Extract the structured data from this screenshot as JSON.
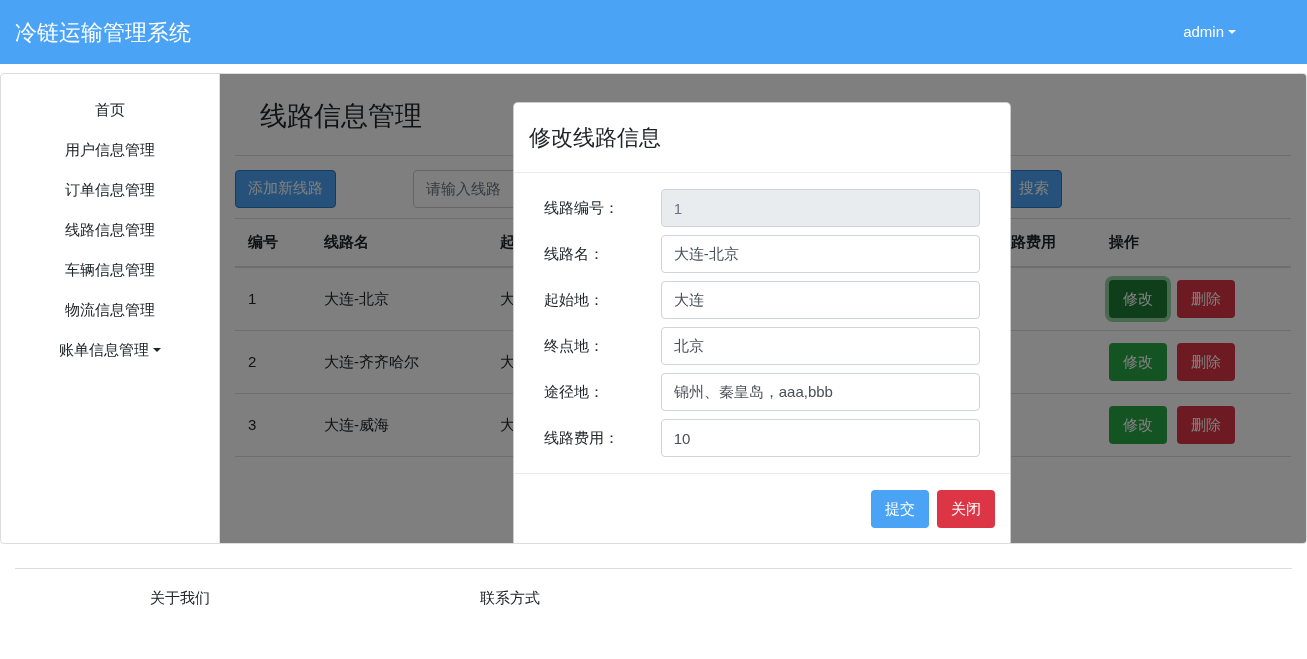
{
  "navbar": {
    "title": "冷链运输管理系统",
    "user_menu": "admin"
  },
  "sidebar": {
    "items": [
      {
        "label": "首页",
        "kind": "link"
      },
      {
        "label": "用户信息管理",
        "kind": "link"
      },
      {
        "label": "订单信息管理",
        "kind": "link"
      },
      {
        "label": "线路信息管理",
        "kind": "link"
      },
      {
        "label": "车辆信息管理",
        "kind": "link"
      },
      {
        "label": "物流信息管理",
        "kind": "link"
      },
      {
        "label": "账单信息管理",
        "kind": "dropdown"
      }
    ]
  },
  "page": {
    "title": "线路信息管理",
    "add_button": "添加新线路",
    "search": {
      "placeholder": "请输入线路"
    },
    "search_button": "搜索",
    "table": {
      "columns": [
        "编号",
        "线路名",
        "起",
        "路费用",
        "操作"
      ],
      "rows": [
        {
          "id": "1",
          "name": "大连-北京",
          "column_3": "大",
          "edit": "修改",
          "delete": "删除",
          "focused": true
        },
        {
          "id": "2",
          "name": "大连-齐齐哈尔",
          "column_3": "大",
          "edit": "修改",
          "delete": "删除",
          "focused": false
        },
        {
          "id": "3",
          "name": "大连-威海",
          "column_3": "大",
          "edit": "修改",
          "delete": "删除",
          "focused": false
        }
      ]
    }
  },
  "modal": {
    "title": "修改线路信息",
    "fields": [
      {
        "label": "线路编号：",
        "value": "1",
        "disabled": true
      },
      {
        "label": "线路名：",
        "value": "大连-北京",
        "disabled": false
      },
      {
        "label": "起始地：",
        "value": "大连",
        "disabled": false
      },
      {
        "label": "终点地：",
        "value": "北京",
        "disabled": false
      },
      {
        "label": "途径地：",
        "value": "锦州、秦皇岛，aaa,bbb",
        "disabled": false
      },
      {
        "label": "线路费用：",
        "value": "10",
        "disabled": false
      }
    ],
    "buttons": [
      {
        "label": "提交",
        "kind": "primary"
      },
      {
        "label": "关闭",
        "kind": "danger"
      }
    ]
  },
  "footer": {
    "links": [
      "关于我们",
      "联系方式"
    ]
  }
}
